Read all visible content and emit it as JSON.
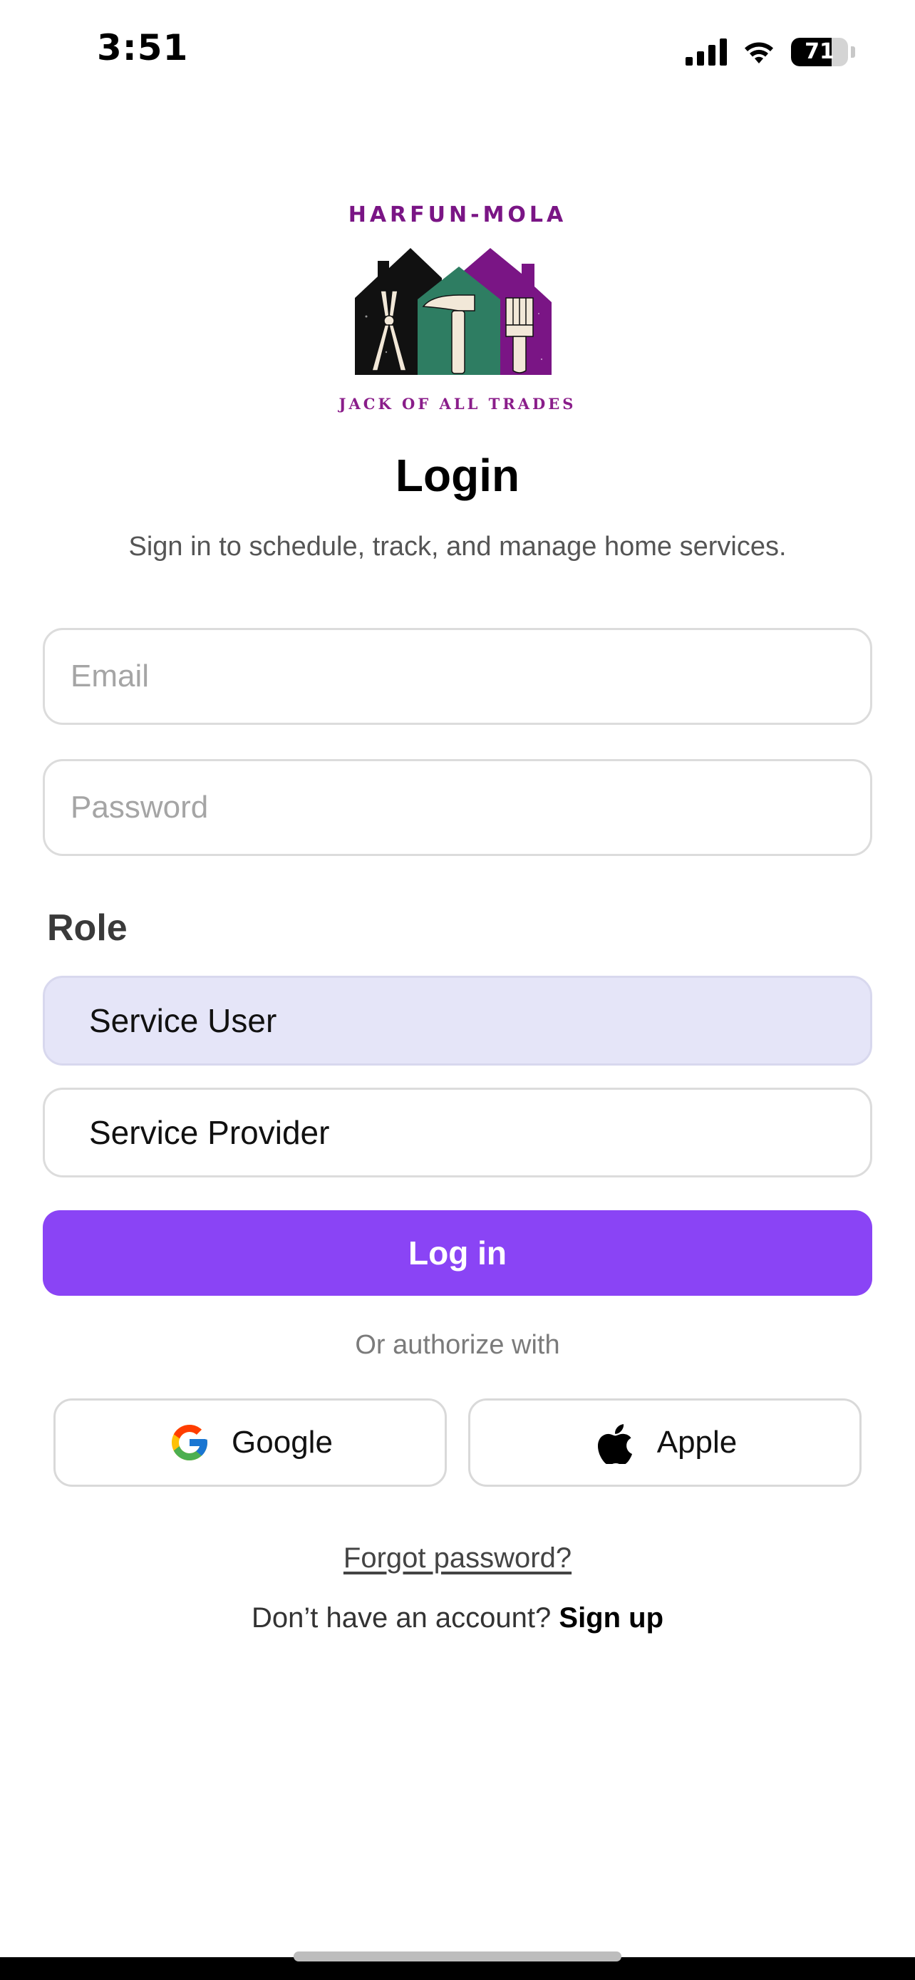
{
  "status_bar": {
    "time": "3:51",
    "battery": "71",
    "battery_level": 0.71
  },
  "logo": {
    "title": "HARFUN-MOLA",
    "tagline": "JACK OF ALL TRADES"
  },
  "header": {
    "title": "Login",
    "subtitle": "Sign in to schedule, track, and manage home services."
  },
  "form": {
    "email_placeholder": "Email",
    "password_placeholder": "Password",
    "role_label": "Role",
    "roles": [
      {
        "label": "Service User",
        "selected": true
      },
      {
        "label": "Service Provider",
        "selected": false
      }
    ],
    "submit_label": "Log in"
  },
  "social": {
    "divider_text": "Or authorize with",
    "google_label": "Google",
    "apple_label": "Apple"
  },
  "footer": {
    "forgot_label": "Forgot password?",
    "signup_prompt": "Don’t have an account?",
    "signup_label": "Sign up"
  },
  "colors": {
    "primary": "#8a44f5",
    "selected_role_bg": "#e5e5f8",
    "logo_purple": "#7a1585",
    "logo_green": "#2e7d62"
  }
}
